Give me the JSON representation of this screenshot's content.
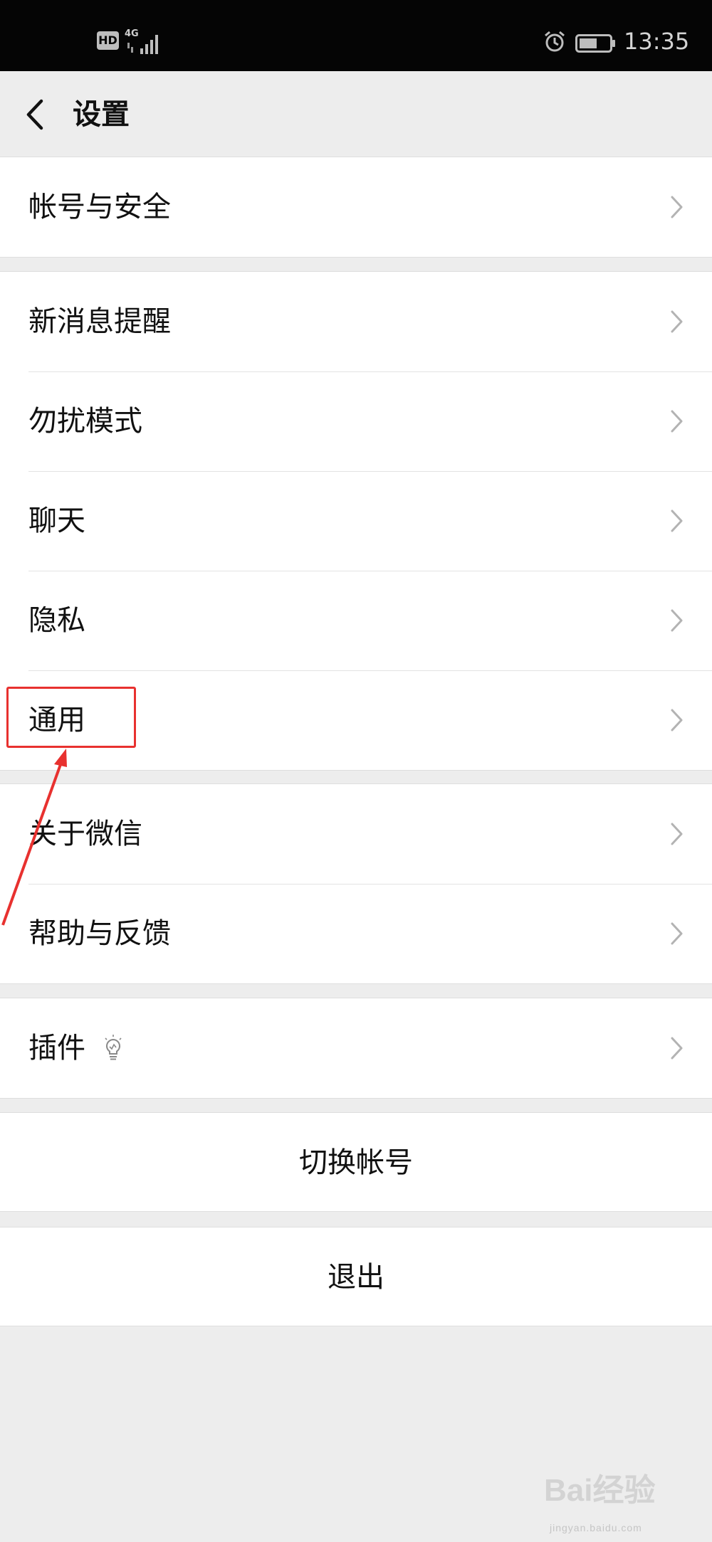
{
  "status_bar": {
    "hd_badge": "HD",
    "network": "4G",
    "time": "13:35"
  },
  "header": {
    "title": "设置"
  },
  "groups": [
    {
      "items": [
        {
          "label": "帐号与安全"
        }
      ]
    },
    {
      "items": [
        {
          "label": "新消息提醒"
        },
        {
          "label": "勿扰模式"
        },
        {
          "label": "聊天"
        },
        {
          "label": "隐私"
        },
        {
          "label": "通用"
        }
      ]
    },
    {
      "items": [
        {
          "label": "关于微信"
        },
        {
          "label": "帮助与反馈"
        }
      ]
    },
    {
      "items": [
        {
          "label": "插件"
        }
      ]
    }
  ],
  "actions": {
    "switch_account": "切换帐号",
    "logout": "退出"
  },
  "watermark": {
    "brand": "Bai经验",
    "url": "jingyan.baidu.com"
  },
  "colors": {
    "page_bg": "#ededed",
    "status_bar_bg": "#050505",
    "annotation": "#e8312f"
  }
}
